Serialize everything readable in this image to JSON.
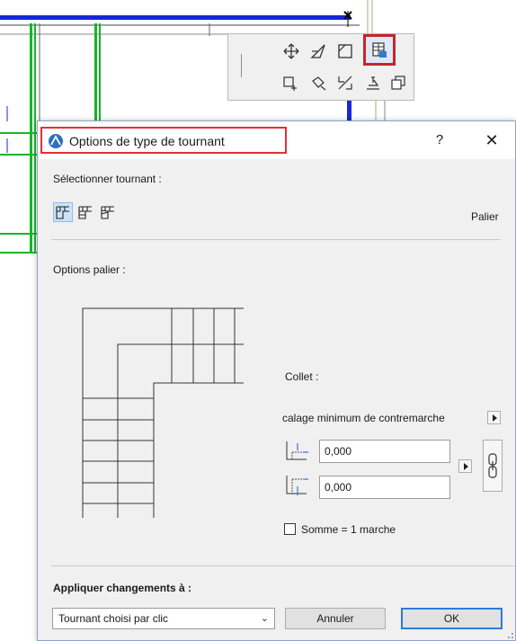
{
  "dialog": {
    "title": "Options de type de tournant",
    "help_label": "?",
    "close_label": "✕",
    "select_label": "Sélectionner tournant :",
    "type_current": "Palier",
    "type_icons": [
      "landing-type-icon",
      "winder-type-icon",
      "diagonal-winder-type-icon"
    ],
    "options_label": "Options palier :",
    "collet_label": "Collet :",
    "offset_label": "calage minimum de contremarche",
    "fields": [
      "0,000",
      "0,000"
    ],
    "sum_label": "Somme = 1 marche",
    "sum_checked": false,
    "apply_label": "Appliquer changements à :",
    "apply_value": "Tournant choisi par clic",
    "cancel_label": "Annuler",
    "ok_label": "OK"
  },
  "toolbar": {
    "icons": [
      "move-icon",
      "rotate-icon",
      "stretch-icon",
      "offset-icon",
      "mirror-icon",
      "split-icon",
      "elevate-icon",
      "multiply-icon",
      "edit-turning-icon"
    ],
    "active_icon": "edit-turning-icon"
  },
  "colors": {
    "accent": "#2f7ad5",
    "highlight": "#e0303a",
    "toolbar_highlight": "#c1272d",
    "cad_blue": "#1428d8",
    "cad_green": "#17b52a"
  }
}
